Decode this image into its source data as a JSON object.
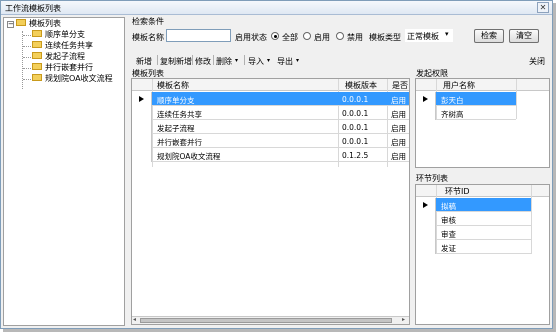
{
  "window": {
    "title": "工作流模板列表",
    "close_glyph": "✕"
  },
  "tree": {
    "root": "模板列表",
    "items": [
      "顺序单分支",
      "连续任务共享",
      "发起子流程",
      "并行嵌套并行",
      "规划院OA收文流程"
    ]
  },
  "search": {
    "section_label": "检索条件",
    "name_label": "模板名称",
    "name_value": "",
    "status_label": "启用状态",
    "status_options": [
      "全部",
      "启用",
      "禁用"
    ],
    "status_selected": "全部",
    "type_label": "模板类型",
    "type_value": "正常模板",
    "search_button": "检索",
    "clear_button": "清空"
  },
  "toolbar": {
    "new": "新增",
    "copy_new": "复制新增",
    "edit": "修改",
    "delete": "删除",
    "import": "导入",
    "export": "导出",
    "close": "关闭"
  },
  "template_grid": {
    "label": "模板列表",
    "columns": [
      "模板名称",
      "模板版本",
      "是否"
    ],
    "rows": [
      {
        "name": "顺序单分支",
        "version": "0.0.0.1",
        "enabled": "启用",
        "selected": true
      },
      {
        "name": "连续任务共享",
        "version": "0.0.0.1",
        "enabled": "启用",
        "selected": false
      },
      {
        "name": "发起子流程",
        "version": "0.0.0.1",
        "enabled": "启用",
        "selected": false
      },
      {
        "name": "并行嵌套并行",
        "version": "0.0.0.1",
        "enabled": "启用",
        "selected": false
      },
      {
        "name": "规划院OA收文流程",
        "version": "0.1.2.5",
        "enabled": "启用",
        "selected": false
      }
    ]
  },
  "initiator_grid": {
    "label": "发起权限",
    "columns": [
      "用户名称"
    ],
    "rows": [
      {
        "name": "彭天白",
        "selected": true
      },
      {
        "name": "齐树高",
        "selected": false
      }
    ]
  },
  "node_grid": {
    "label": "环节列表",
    "columns": [
      "环节ID"
    ],
    "rows": [
      {
        "name": "拟稿",
        "selected": true
      },
      {
        "name": "审核",
        "selected": false
      },
      {
        "name": "审查",
        "selected": false
      },
      {
        "name": "发证",
        "selected": false
      }
    ]
  },
  "colors": {
    "selection": "#3399ff",
    "title_bar": "#dfe8f3"
  }
}
